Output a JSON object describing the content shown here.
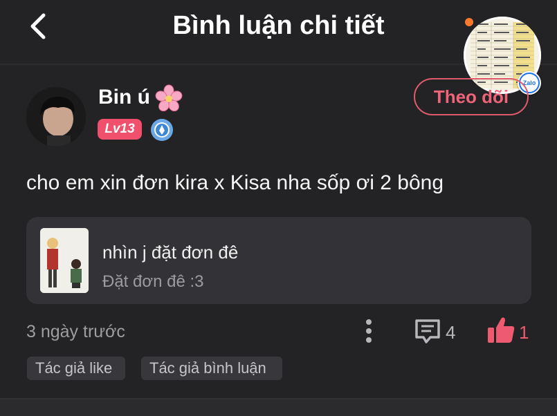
{
  "header": {
    "title": "Bình luận chi tiết",
    "back_icon": "chevron-left-icon"
  },
  "floating_bubble": {
    "badge_label": "Zalo",
    "dot_color": "#ff7a2f"
  },
  "author": {
    "name": "Bin ú",
    "name_emoji_icon": "cherry-blossom-icon",
    "level": "Lv13",
    "level_color": "#f0506b",
    "badge_icon": "shield-badge-icon",
    "follow_label": "Theo dõi"
  },
  "comment": {
    "text": "cho em xin đơn kira x Kisa nha sốp ơi 2 bông"
  },
  "linked_post": {
    "title": "nhìn j đặt đơn đê",
    "subtitle": "Đặt đơn đê :3"
  },
  "meta": {
    "time": "3 ngày trước",
    "comment_count": "4",
    "like_count": "1",
    "accent_color": "#ee5a6f"
  },
  "tags": [
    "Tác giả like",
    "Tác giả bình luận"
  ]
}
